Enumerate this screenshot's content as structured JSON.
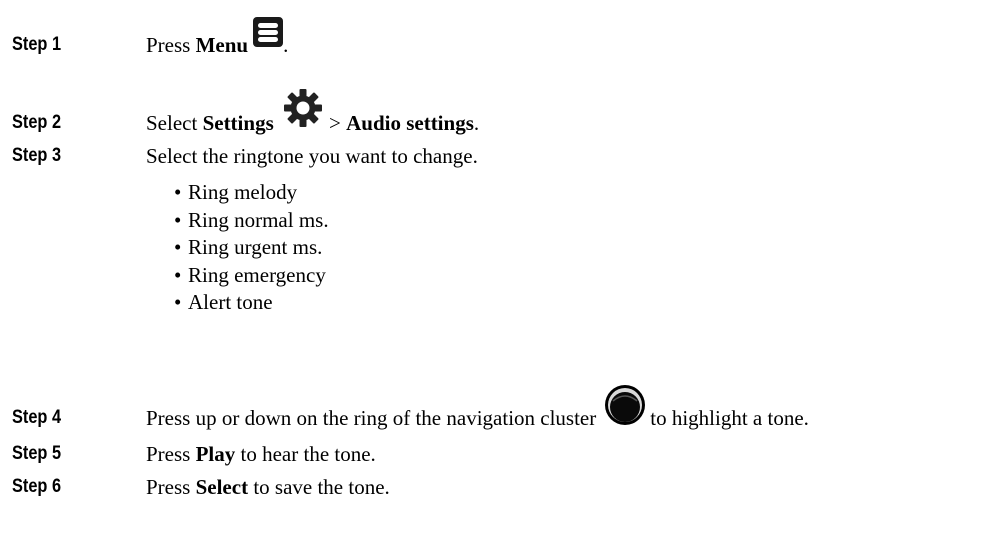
{
  "steps": [
    {
      "label": "Step 1",
      "pre": "Press ",
      "bold": "Menu",
      "icon": "menu-icon",
      "post": "."
    },
    {
      "label": "Step 2",
      "pre": "Select ",
      "bold": "Settings",
      "icon": "settings-gear-icon",
      "mid": " > ",
      "bold2": "Audio settings",
      "post": "."
    },
    {
      "label": "Step 3",
      "text": "Select the ringtone you want to change.",
      "options": [
        "Ring melody",
        "Ring normal ms.",
        "Ring urgent ms.",
        "Ring emergency",
        "Alert tone"
      ]
    },
    {
      "label": "Step 4",
      "pre": "Press up or down on the ring of the navigation cluster",
      "icon": "navigation-cluster-icon",
      "post": "to highlight a tone."
    },
    {
      "label": "Step 5",
      "pre": "Press ",
      "bold": "Play",
      "post": " to hear the tone."
    },
    {
      "label": "Step 6",
      "pre": "Press ",
      "bold": "Select",
      "post": " to save the tone."
    }
  ]
}
